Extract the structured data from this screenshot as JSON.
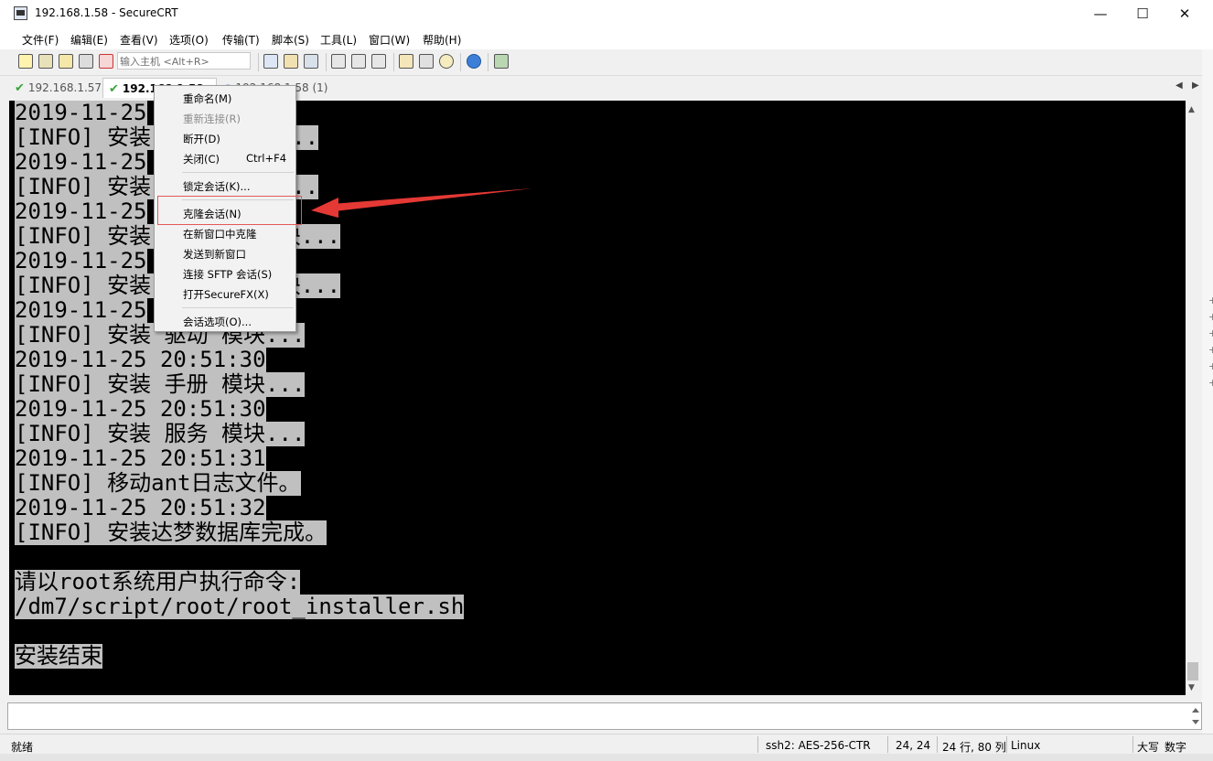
{
  "window": {
    "title": "192.168.1.58 - SecureCRT",
    "minimize": "—",
    "maximize": "☐",
    "close": "✕"
  },
  "menu": [
    "文件(F)",
    "编辑(E)",
    "查看(V)",
    "选项(O)",
    "传输(T)",
    "脚本(S)",
    "工具(L)",
    "窗口(W)",
    "帮助(H)"
  ],
  "toolbar": {
    "host_placeholder": "输入主机 <Alt+R>"
  },
  "tabs": [
    {
      "label": "192.168.1.57",
      "status": "connected"
    },
    {
      "label": "192.168.1.58",
      "status": "connected",
      "active": true
    },
    {
      "label": "192.168.1.58 (1)",
      "status": "connecting"
    }
  ],
  "terminal": {
    "lines": [
      "2019-11-25",
      "[INFO] 安装        库...",
      "2019-11-25",
      "[INFO] 安装        块...",
      "2019-11-25",
      "[INFO] 安装        模块...",
      "2019-11-25",
      "[INFO] 安装        模块...",
      "2019-11-25",
      "[INFO] 安装 驱动 模块...",
      "2019-11-25 20:51:30",
      "[INFO] 安装 手册 模块...",
      "2019-11-25 20:51:30",
      "[INFO] 安装 服务 模块...",
      "2019-11-25 20:51:31",
      "[INFO] 移动ant日志文件。",
      "2019-11-25 20:51:32",
      "[INFO] 安装达梦数据库完成。",
      "",
      "请以root系统用户执行命令:",
      "/dm7/script/root/root_installer.sh",
      "",
      "安装结束"
    ]
  },
  "context_menu": {
    "items": [
      {
        "label": "重命名(M)",
        "enabled": true
      },
      {
        "label": "重新连接(R)",
        "enabled": false
      },
      {
        "label": "断开(D)",
        "enabled": true
      },
      {
        "label": "关闭(C)",
        "shortcut": "Ctrl+F4",
        "enabled": true
      },
      {
        "label": "锁定会话(K)...",
        "enabled": true
      },
      {
        "label": "克隆会话(N)",
        "enabled": true,
        "highlighted": true
      },
      {
        "label": "在新窗口中克隆",
        "enabled": true
      },
      {
        "label": "发送到新窗口",
        "enabled": true
      },
      {
        "label": "连接 SFTP 会话(S)",
        "enabled": true
      },
      {
        "label": "打开SecureFX(X)",
        "enabled": true
      },
      {
        "label": "会话选项(O)...",
        "enabled": true
      }
    ]
  },
  "status": {
    "ready": "就绪",
    "cipher": "ssh2: AES-256-CTR",
    "cursor": "24,  24",
    "size": "24 行, 80 列",
    "os": "Linux",
    "caps": "大写",
    "num": "数字"
  },
  "colors": {
    "terminal_bg": "#000000",
    "terminal_text_bg": "#c0c0c0",
    "annotation": "#e53935",
    "tab_check": "#3aa53a"
  }
}
